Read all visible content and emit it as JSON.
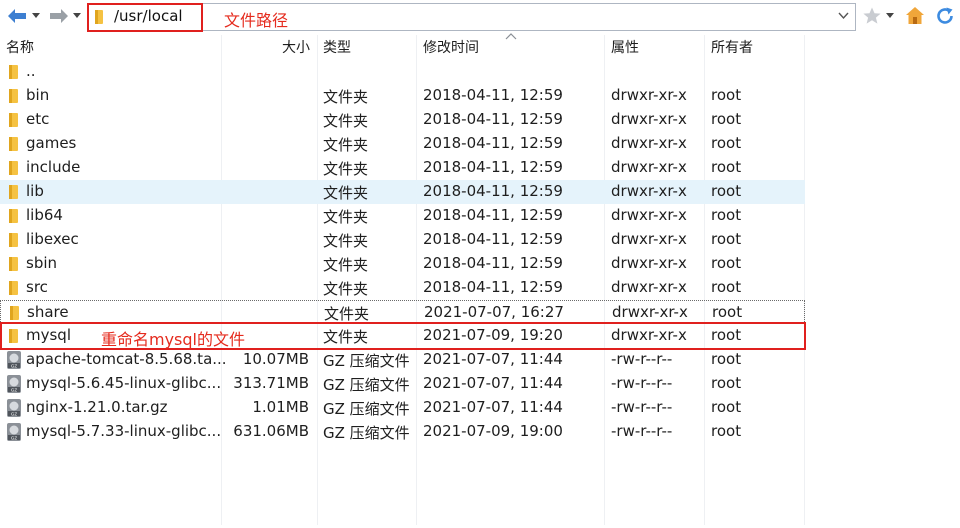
{
  "toolbar": {
    "back_icon": "back-arrow-icon",
    "forward_icon": "forward-arrow-icon",
    "path": "/usr/local",
    "path_annotation": "文件路径",
    "bookmark_icon": "star-icon",
    "home_icon": "home-icon",
    "refresh_icon": "refresh-icon"
  },
  "columns": {
    "name": "名称",
    "size": "大小",
    "type": "类型",
    "modified": "修改时间",
    "attrs": "属性",
    "owner": "所有者"
  },
  "rows": [
    {
      "name": "..",
      "size": "",
      "type": "",
      "modified": "",
      "attrs": "",
      "owner": "",
      "icon": "folder-icon"
    },
    {
      "name": "bin",
      "size": "",
      "type": "文件夹",
      "modified": "2018-04-11, 12:59",
      "attrs": "drwxr-xr-x",
      "owner": "root",
      "icon": "folder-icon"
    },
    {
      "name": "etc",
      "size": "",
      "type": "文件夹",
      "modified": "2018-04-11, 12:59",
      "attrs": "drwxr-xr-x",
      "owner": "root",
      "icon": "folder-icon"
    },
    {
      "name": "games",
      "size": "",
      "type": "文件夹",
      "modified": "2018-04-11, 12:59",
      "attrs": "drwxr-xr-x",
      "owner": "root",
      "icon": "folder-icon"
    },
    {
      "name": "include",
      "size": "",
      "type": "文件夹",
      "modified": "2018-04-11, 12:59",
      "attrs": "drwxr-xr-x",
      "owner": "root",
      "icon": "folder-icon"
    },
    {
      "name": "lib",
      "size": "",
      "type": "文件夹",
      "modified": "2018-04-11, 12:59",
      "attrs": "drwxr-xr-x",
      "owner": "root",
      "icon": "folder-icon"
    },
    {
      "name": "lib64",
      "size": "",
      "type": "文件夹",
      "modified": "2018-04-11, 12:59",
      "attrs": "drwxr-xr-x",
      "owner": "root",
      "icon": "folder-icon"
    },
    {
      "name": "libexec",
      "size": "",
      "type": "文件夹",
      "modified": "2018-04-11, 12:59",
      "attrs": "drwxr-xr-x",
      "owner": "root",
      "icon": "folder-icon"
    },
    {
      "name": "sbin",
      "size": "",
      "type": "文件夹",
      "modified": "2018-04-11, 12:59",
      "attrs": "drwxr-xr-x",
      "owner": "root",
      "icon": "folder-icon"
    },
    {
      "name": "src",
      "size": "",
      "type": "文件夹",
      "modified": "2018-04-11, 12:59",
      "attrs": "drwxr-xr-x",
      "owner": "root",
      "icon": "folder-icon"
    },
    {
      "name": "share",
      "size": "",
      "type": "文件夹",
      "modified": "2021-07-07, 16:27",
      "attrs": "drwxr-xr-x",
      "owner": "root",
      "icon": "folder-icon"
    },
    {
      "name": "mysql",
      "size": "",
      "type": "文件夹",
      "modified": "2021-07-09, 19:20",
      "attrs": "drwxr-xr-x",
      "owner": "root",
      "icon": "folder-icon"
    },
    {
      "name": "apache-tomcat-8.5.68.ta...",
      "size": "10.07MB",
      "type": "GZ 压缩文件",
      "modified": "2021-07-07, 11:44",
      "attrs": "-rw-r--r--",
      "owner": "root",
      "icon": "gz-archive-icon"
    },
    {
      "name": "mysql-5.6.45-linux-glibc...",
      "size": "313.71MB",
      "type": "GZ 压缩文件",
      "modified": "2021-07-07, 11:44",
      "attrs": "-rw-r--r--",
      "owner": "root",
      "icon": "gz-archive-icon"
    },
    {
      "name": "nginx-1.21.0.tar.gz",
      "size": "1.01MB",
      "type": "GZ 压缩文件",
      "modified": "2021-07-07, 11:44",
      "attrs": "-rw-r--r--",
      "owner": "root",
      "icon": "gz-archive-icon"
    },
    {
      "name": "mysql-5.7.33-linux-glibc...",
      "size": "631.06MB",
      "type": "GZ 压缩文件",
      "modified": "2021-07-09, 19:00",
      "attrs": "-rw-r--r--",
      "owner": "root",
      "icon": "gz-archive-icon"
    }
  ],
  "row_annotation": "重命名mysql的文件",
  "colors": {
    "annotation_red": "#e0201e",
    "selected_row": "#e5f3fb",
    "folder_yellow": "#f5c242"
  }
}
